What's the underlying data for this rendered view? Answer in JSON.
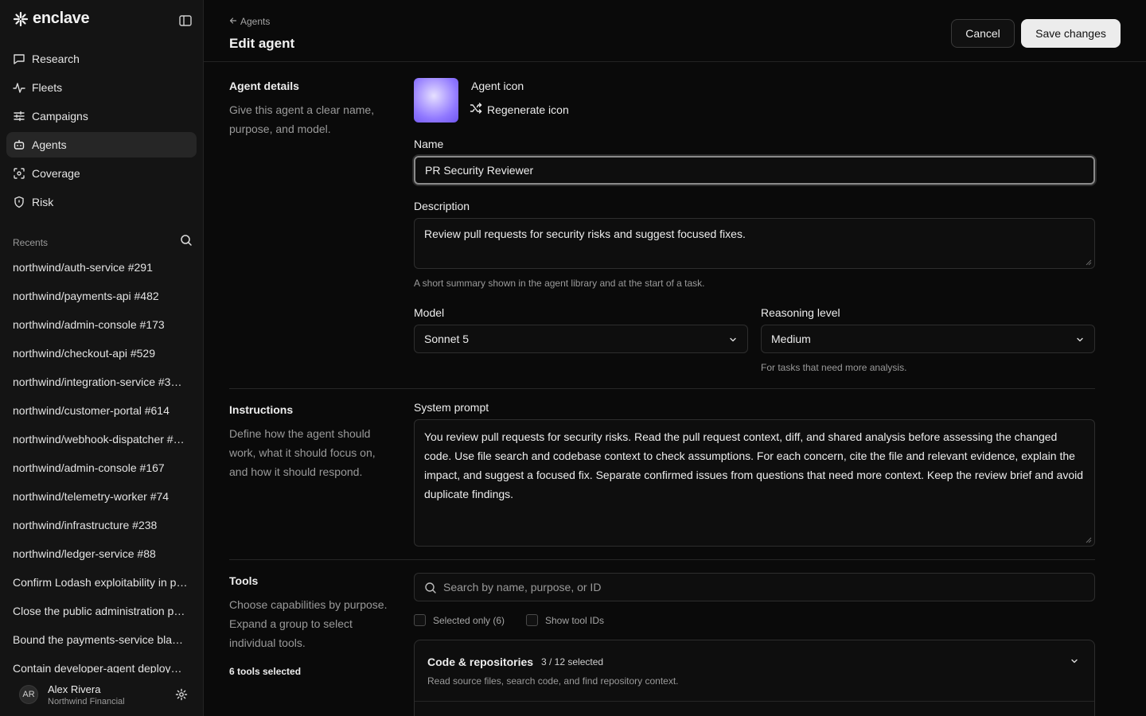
{
  "sidebar": {
    "brand": "enclave",
    "nav": [
      {
        "label": "Research",
        "icon": "chat-bubble-icon"
      },
      {
        "label": "Fleets",
        "icon": "activity-icon"
      },
      {
        "label": "Campaigns",
        "icon": "sliders-icon"
      },
      {
        "label": "Agents",
        "icon": "bot-icon",
        "active": true
      },
      {
        "label": "Coverage",
        "icon": "scan-icon"
      },
      {
        "label": "Risk",
        "icon": "shield-icon"
      }
    ],
    "recents_title": "Recents",
    "recents": [
      "northwind/auth-service #291",
      "northwind/payments-api #482",
      "northwind/admin-console #173",
      "northwind/checkout-api #529",
      "northwind/integration-service #3…",
      "northwind/customer-portal #614",
      "northwind/webhook-dispatcher #…",
      "northwind/admin-console #167",
      "northwind/telemetry-worker #74",
      "northwind/infrastructure #238",
      "northwind/ledger-service #88",
      "Confirm Lodash exploitability in p…",
      "Close the public administration p…",
      "Bound the payments-service bla…",
      "Contain developer-agent deploy…"
    ],
    "user": {
      "initials": "AR",
      "name": "Alex Rivera",
      "org": "Northwind Financial"
    }
  },
  "header": {
    "back_label": "Agents",
    "title": "Edit agent",
    "cancel_label": "Cancel",
    "save_label": "Save changes"
  },
  "agent_details": {
    "title": "Agent details",
    "description": "Give this agent a clear name, purpose, and model.",
    "icon_label": "Agent icon",
    "regenerate_label": "Regenerate icon",
    "name_label": "Name",
    "name_value": "PR Security Reviewer",
    "description_label": "Description",
    "description_value": "Review pull requests for security risks and suggest focused fixes.",
    "description_help": "A short summary shown in the agent library and at the start of a task.",
    "model_label": "Model",
    "model_value": "Sonnet 5",
    "reasoning_label": "Reasoning level",
    "reasoning_value": "Medium",
    "reasoning_help": "For tasks that need more analysis."
  },
  "instructions": {
    "title": "Instructions",
    "description": "Define how the agent should work, what it should focus on, and how it should respond.",
    "prompt_label": "System prompt",
    "prompt_value": "You review pull requests for security risks. Read the pull request context, diff, and shared analysis before assessing the changed code. Use file search and codebase context to check assumptions. For each concern, cite the file and relevant evidence, explain the impact, and suggest a focused fix. Separate confirmed issues from questions that need more context. Keep the review brief and avoid duplicate findings."
  },
  "tools": {
    "title": "Tools",
    "description": "Choose capabilities by purpose. Expand a group to select individual tools.",
    "selected_summary": "6 tools selected",
    "search_placeholder": "Search by name, purpose, or ID",
    "selected_only_label": "Selected only (6)",
    "show_ids_label": "Show tool IDs",
    "groups": [
      {
        "title": "Code & repositories",
        "count": "3 / 12 selected",
        "description": "Read source files, search code, and find repository context."
      }
    ]
  }
}
